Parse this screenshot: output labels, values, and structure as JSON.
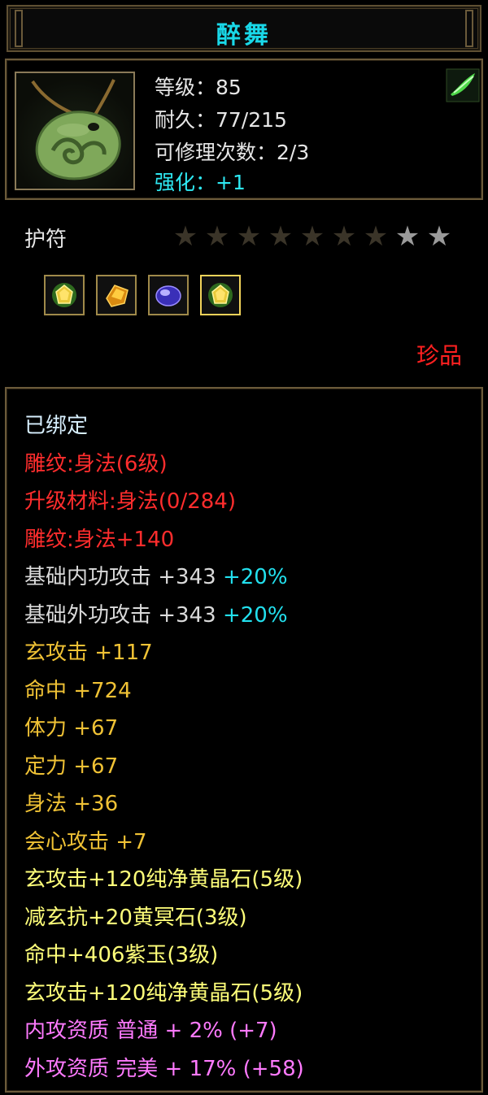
{
  "window": {
    "title": "醉舞"
  },
  "item": {
    "icon": "jade-pendant-icon",
    "level_label": "等级：85",
    "durability_label": "耐久：77/215",
    "repair_label": "可修理次数：2/3",
    "enhance_label": "强化：+1",
    "corner_icon": "green-feather-icon"
  },
  "type": {
    "label": "护符",
    "stars_total": 9,
    "stars_dim": 7,
    "stars_lit": 2
  },
  "gems": [
    {
      "icon": "yellow-gem-icon"
    },
    {
      "icon": "amber-gem-icon"
    },
    {
      "icon": "purple-gem-icon"
    },
    {
      "icon": "yellow-gem-icon",
      "selected": true
    }
  ],
  "rarity": "珍品",
  "attributes": [
    {
      "text": "已绑定",
      "color": "#d8f0ff"
    },
    {
      "text": "雕纹:身法(6级)",
      "color": "#ff2d2d"
    },
    {
      "text": "升级材料:身法(0/284)",
      "color": "#ff2d2d"
    },
    {
      "text": "雕纹:身法+140",
      "color": "#ff2d2d"
    },
    {
      "text": "基础内功攻击 +343",
      "bonus": "+20%",
      "color": "#dadada"
    },
    {
      "text": "基础外功攻击 +343",
      "bonus": "+20%",
      "color": "#dadada"
    },
    {
      "text": "玄攻击 +117",
      "color": "#f0c235"
    },
    {
      "text": "命中 +724",
      "color": "#f0c235"
    },
    {
      "text": "体力 +67",
      "color": "#f0c235"
    },
    {
      "text": "定力 +67",
      "color": "#f0c235"
    },
    {
      "text": "身法 +36",
      "color": "#f0c235"
    },
    {
      "text": "会心攻击 +7",
      "color": "#f0c235"
    },
    {
      "text": "玄攻击+120纯净黄晶石(5级)",
      "color": "#ffff7a"
    },
    {
      "text": "减玄抗+20黄冥石(3级)",
      "color": "#ffff7a"
    },
    {
      "text": "命中+406紫玉(3级)",
      "color": "#ffff7a"
    },
    {
      "text": "玄攻击+120纯净黄晶石(5级)",
      "color": "#ffff7a"
    },
    {
      "text": "内攻资质 普通 + 2% (+7)",
      "color": "#ff7aff"
    },
    {
      "text": "外攻资质 完美 + 17% (+58)",
      "color": "#ff7aff"
    }
  ]
}
